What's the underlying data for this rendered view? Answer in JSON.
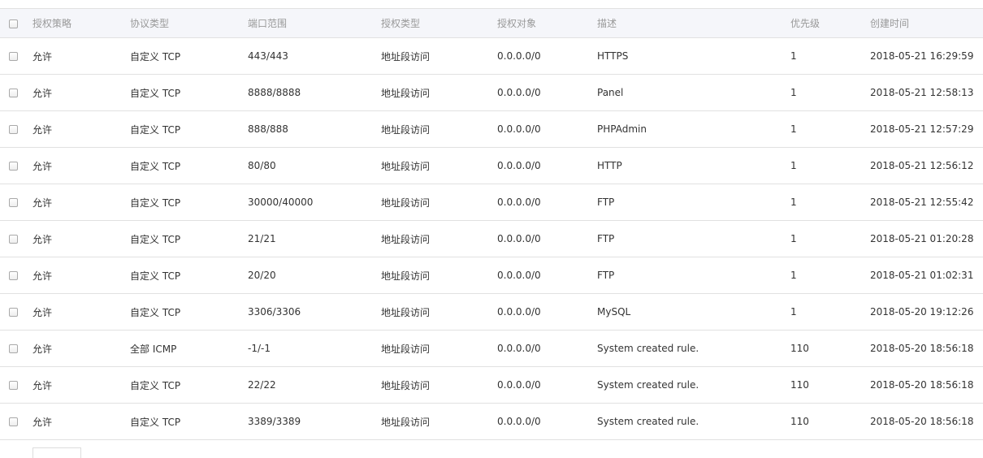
{
  "table": {
    "headers": {
      "policy": "授权策略",
      "protocol": "协议类型",
      "port_range": "端口范围",
      "auth_type": "授权类型",
      "auth_object": "授权对象",
      "description": "描述",
      "priority": "优先级",
      "created": "创建时间"
    },
    "rows": [
      {
        "policy": "允许",
        "protocol": "自定义 TCP",
        "port_range": "443/443",
        "auth_type": "地址段访问",
        "auth_object": "0.0.0.0/0",
        "description": "HTTPS",
        "priority": "1",
        "created": "2018-05-21 16:29:59"
      },
      {
        "policy": "允许",
        "protocol": "自定义 TCP",
        "port_range": "8888/8888",
        "auth_type": "地址段访问",
        "auth_object": "0.0.0.0/0",
        "description": "Panel",
        "priority": "1",
        "created": "2018-05-21 12:58:13"
      },
      {
        "policy": "允许",
        "protocol": "自定义 TCP",
        "port_range": "888/888",
        "auth_type": "地址段访问",
        "auth_object": "0.0.0.0/0",
        "description": "PHPAdmin",
        "priority": "1",
        "created": "2018-05-21 12:57:29"
      },
      {
        "policy": "允许",
        "protocol": "自定义 TCP",
        "port_range": "80/80",
        "auth_type": "地址段访问",
        "auth_object": "0.0.0.0/0",
        "description": "HTTP",
        "priority": "1",
        "created": "2018-05-21 12:56:12"
      },
      {
        "policy": "允许",
        "protocol": "自定义 TCP",
        "port_range": "30000/40000",
        "auth_type": "地址段访问",
        "auth_object": "0.0.0.0/0",
        "description": "FTP",
        "priority": "1",
        "created": "2018-05-21 12:55:42"
      },
      {
        "policy": "允许",
        "protocol": "自定义 TCP",
        "port_range": "21/21",
        "auth_type": "地址段访问",
        "auth_object": "0.0.0.0/0",
        "description": "FTP",
        "priority": "1",
        "created": "2018-05-21 01:20:28"
      },
      {
        "policy": "允许",
        "protocol": "自定义 TCP",
        "port_range": "20/20",
        "auth_type": "地址段访问",
        "auth_object": "0.0.0.0/0",
        "description": "FTP",
        "priority": "1",
        "created": "2018-05-21 01:02:31"
      },
      {
        "policy": "允许",
        "protocol": "自定义 TCP",
        "port_range": "3306/3306",
        "auth_type": "地址段访问",
        "auth_object": "0.0.0.0/0",
        "description": "MySQL",
        "priority": "1",
        "created": "2018-05-20 19:12:26"
      },
      {
        "policy": "允许",
        "protocol": "全部 ICMP",
        "port_range": "-1/-1",
        "auth_type": "地址段访问",
        "auth_object": "0.0.0.0/0",
        "description": "System created rule.",
        "priority": "110",
        "created": "2018-05-20 18:56:18"
      },
      {
        "policy": "允许",
        "protocol": "自定义 TCP",
        "port_range": "22/22",
        "auth_type": "地址段访问",
        "auth_object": "0.0.0.0/0",
        "description": "System created rule.",
        "priority": "110",
        "created": "2018-05-20 18:56:18"
      },
      {
        "policy": "允许",
        "protocol": "自定义 TCP",
        "port_range": "3389/3389",
        "auth_type": "地址段访问",
        "auth_object": "0.0.0.0/0",
        "description": "System created rule.",
        "priority": "110",
        "created": "2018-05-20 18:56:18"
      }
    ]
  }
}
